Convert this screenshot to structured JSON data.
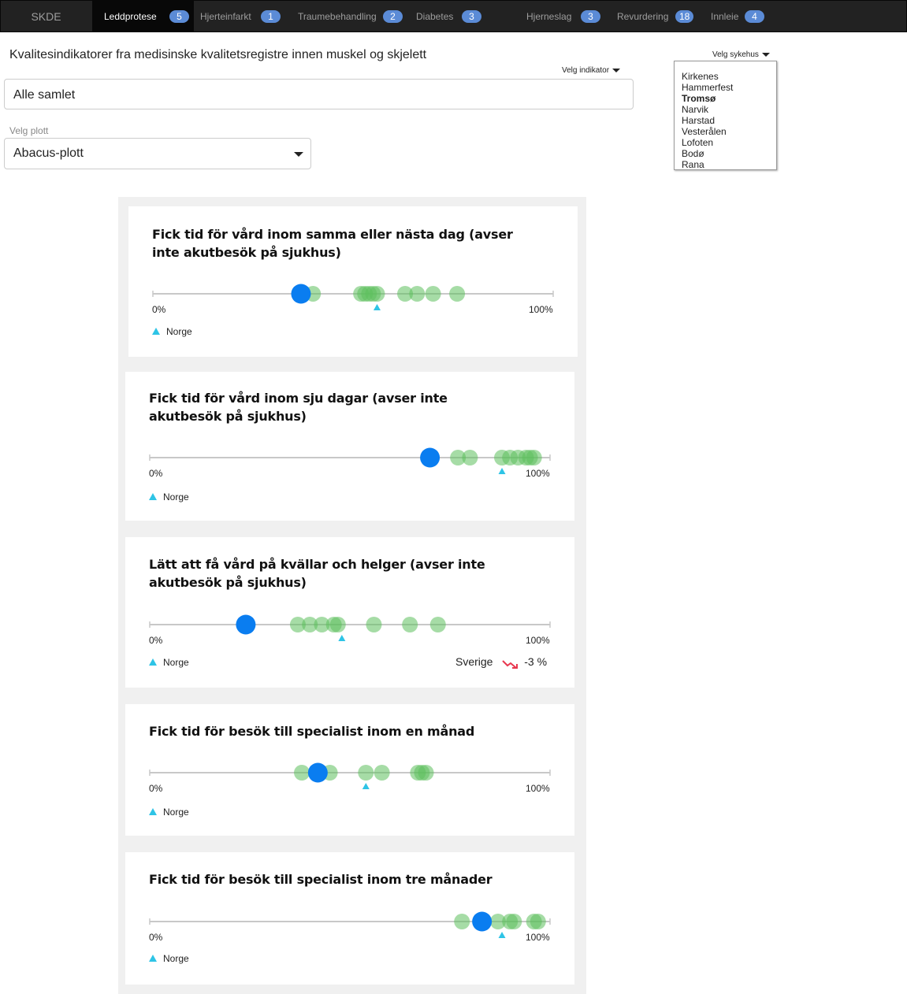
{
  "nav": {
    "brand": "SKDE",
    "tabs": [
      {
        "label": "Leddprotese",
        "badge": "5",
        "active": true
      },
      {
        "label": "Hjerteinfarkt",
        "badge": "1"
      },
      {
        "label": "Traumebehandling",
        "badge": "2"
      },
      {
        "label": "Diabetes",
        "badge": "3"
      },
      {
        "label": "Hjerneslag",
        "badge": "3"
      },
      {
        "label": "Revurdering",
        "badge": "18"
      },
      {
        "label": "Innleie",
        "badge": "4"
      }
    ]
  },
  "header": {
    "title": "Kvalitesindikatorer fra medisinske kvalitetsregistre innen muskel og skjelett",
    "indicator_dropdown_label": "Velg indikator",
    "hospital_dropdown_label": "Velg sykehus",
    "indicator_value": "Alle samlet",
    "plot_label": "Velg plott",
    "plot_value": "Abacus-plott"
  },
  "hospitals": {
    "items": [
      "Kirkenes",
      "Hammerfest",
      "Tromsø",
      "Narvik",
      "Harstad",
      "Vesterålen",
      "Lofoten",
      "Bodø",
      "Rana"
    ],
    "selected": "Tromsø"
  },
  "colors": {
    "selected_dot": "#0a7df0",
    "other_dot": "#5cbf5c",
    "national_marker": "#2ec4e6",
    "trend_down": "#e8384f"
  },
  "charts": {
    "axis_min_label": "0%",
    "axis_max_label": "100%",
    "legend_label": "Norge",
    "items": [
      {
        "title": "Fick tid för vård inom samma eller nästa dag (avser inte akutbesök på sjukhus)",
        "chart_data": {
          "type": "scatter",
          "xlim": [
            0,
            100
          ],
          "selected": 37,
          "national": 56,
          "others": [
            40,
            52,
            53,
            54,
            55,
            56,
            63,
            66,
            70,
            76
          ]
        }
      },
      {
        "title": "Fick tid för vård inom sju dagar (avser inte akutbesök på sjukhus)",
        "chart_data": {
          "type": "scatter",
          "xlim": [
            0,
            100
          ],
          "selected": 70,
          "national": 88,
          "others": [
            77,
            80,
            88,
            90,
            92,
            94,
            95,
            96
          ]
        }
      },
      {
        "title": "Lätt att få vård på kvällar och helger (avser inte akutbesök på sjukhus)",
        "chart_data": {
          "type": "scatter",
          "xlim": [
            0,
            100
          ],
          "selected": 24,
          "national": 48,
          "others": [
            37,
            40,
            43,
            46,
            47,
            56,
            65,
            72
          ]
        },
        "trend": {
          "label": "Sverige",
          "value": "-3 %"
        }
      },
      {
        "title": "Fick tid för besök till specialist inom en månad",
        "chart_data": {
          "type": "scatter",
          "xlim": [
            0,
            100
          ],
          "selected": 42,
          "national": 54,
          "others": [
            38,
            45,
            54,
            58,
            67,
            68,
            69
          ]
        }
      },
      {
        "title": "Fick tid för besök till specialist inom tre månader",
        "chart_data": {
          "type": "scatter",
          "xlim": [
            0,
            100
          ],
          "selected": 83,
          "national": 88,
          "others": [
            78,
            87,
            90,
            91,
            96,
            97
          ]
        }
      }
    ]
  }
}
